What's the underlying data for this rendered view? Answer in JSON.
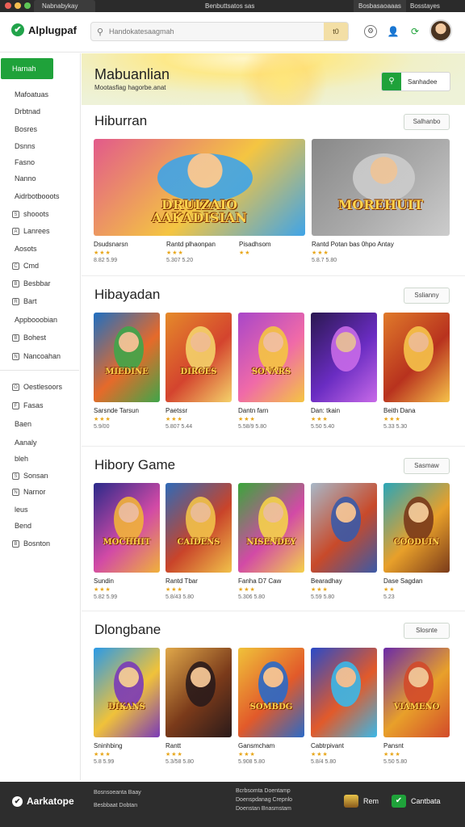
{
  "os_bar": {
    "tab_title": "Nabnabykay",
    "center_text": "Benbuttsatos  sas",
    "right_tab": "Bosbasaoaaas",
    "right_text": "Bosstayes"
  },
  "header": {
    "logo": "Alplugpaf",
    "search_placeholder": "Handokatesaagmah",
    "search_button": "t0"
  },
  "sidebar": {
    "active": "Harnah",
    "items": [
      {
        "label": "Mafoatuas",
        "icon": ""
      },
      {
        "label": "Drbtnad",
        "icon": ""
      },
      {
        "label": "Bosres",
        "icon": ""
      },
      {
        "label": "Dsnns",
        "icon": ""
      },
      {
        "label": "Fasno",
        "icon": ""
      },
      {
        "label": "Nanno",
        "icon": ""
      },
      {
        "label": "Aidrbotbooots",
        "icon": ""
      },
      {
        "label": "shooots",
        "icon": "S"
      },
      {
        "label": "Lanrees",
        "icon": "A"
      },
      {
        "label": "Aosots",
        "icon": ""
      },
      {
        "label": "Cmd",
        "icon": "C"
      },
      {
        "label": "Besbbar",
        "icon": "B"
      },
      {
        "label": "Bart",
        "icon": "R"
      },
      {
        "label": "Appbooobian",
        "icon": ""
      },
      {
        "label": "Bohest",
        "icon": "B"
      },
      {
        "label": "Nancoahan",
        "icon": "N"
      },
      {
        "label": "Oestlesoors",
        "icon": "O"
      },
      {
        "label": "Fasas",
        "icon": "F"
      },
      {
        "label": "Baen",
        "icon": ""
      },
      {
        "label": "Aanaly",
        "icon": ""
      },
      {
        "label": "bleh",
        "icon": ""
      },
      {
        "label": "Sonsan",
        "icon": "S"
      },
      {
        "label": "Narnor",
        "icon": "N"
      },
      {
        "label": "leus",
        "icon": ""
      },
      {
        "label": "Bend",
        "icon": ""
      },
      {
        "label": "Bosnton",
        "icon": "B"
      }
    ]
  },
  "hero": {
    "title": "Mabuanlian",
    "subtitle": "Mootasfiag hagorbe.anat",
    "button": "Sanhadee"
  },
  "sections": [
    {
      "title": "Hiburran",
      "more": "Salhanbo",
      "cards": [
        {
          "name": "Dsudsnarsn",
          "stars": "★★★",
          "meta": "8.82 5.99",
          "label": "DRUIZAIO\nAAKADISIAN"
        },
        {
          "name": "Rantd plhaonpan",
          "stars": "★★★",
          "meta": "5.307 5.20",
          "label": ""
        },
        {
          "name": "Pisadhsom",
          "stars": "★★",
          "meta": "",
          "label": ""
        },
        {
          "name": "Rantd Potan bas 0hpo Antay",
          "stars": "★★★",
          "meta": "5.8.7 5.80",
          "label": "MOREHUIT"
        }
      ]
    },
    {
      "title": "Hibayadan",
      "more": "Sslianny",
      "cards": [
        {
          "name": "Sarsnde Tarsun",
          "stars": "★★★",
          "meta": "5.9/00",
          "label": "MIEDINE"
        },
        {
          "name": "Paetssr",
          "stars": "★★★",
          "meta": "5.807 5.44",
          "label": "DIRGES"
        },
        {
          "name": "Dantn farn",
          "stars": "★★★",
          "meta": "5.58/9 5.80",
          "label": "SONARS"
        },
        {
          "name": "Dan: tkain",
          "stars": "★★★",
          "meta": "5.50 5.40",
          "label": ""
        },
        {
          "name": "Beith Dana",
          "stars": "★★★",
          "meta": "5.33 5.30",
          "label": ""
        }
      ]
    },
    {
      "title": "Hibory Game",
      "more": "Sasmaw",
      "cards": [
        {
          "name": "Sundin",
          "stars": "★★★",
          "meta": "5.82 5.99",
          "label": "MOCHHIT"
        },
        {
          "name": "Rantd Tbar",
          "stars": "★★★",
          "meta": "5.8/43 5.80",
          "label": "CAIDENS"
        },
        {
          "name": "Fanha D7 Caw",
          "stars": "★★★",
          "meta": "5.306 5.80",
          "label": "NISENDEY"
        },
        {
          "name": "Bearadhay",
          "stars": "★★★",
          "meta": "5.59 5.80",
          "label": ""
        },
        {
          "name": "Dase Sagdan",
          "stars": "★★",
          "meta": "5.23",
          "label": "COODUIN"
        }
      ]
    },
    {
      "title": "Dlongbane",
      "more": "Slosnte",
      "cards": [
        {
          "name": "Sninhbing",
          "stars": "★★★",
          "meta": "5.8 5.99",
          "label": "DIKANS"
        },
        {
          "name": "Rantt",
          "stars": "★★★",
          "meta": "5.3/58 5.80",
          "label": ""
        },
        {
          "name": "Gansmcham",
          "stars": "★★★",
          "meta": "5.908 5.80",
          "label": "SOMBDG"
        },
        {
          "name": "Cabtrpivant",
          "stars": "★★★",
          "meta": "5.8/4 5.80",
          "label": ""
        },
        {
          "name": "Pansnt",
          "stars": "★★★",
          "meta": "5.50 5.80",
          "label": "VIAMENO"
        }
      ]
    }
  ],
  "footer": {
    "logo": "Aarkatope",
    "col1_line1": "Bosnsoeanta Baay",
    "col1_line2": "Besbbaat Dobtan",
    "col2_line1": "Bcrbsomta Doentamp",
    "col2_line2": "Doenspdanag Crepnlo",
    "col2_line3": "Doenstan Bnasmstam",
    "btn1": "Rem",
    "btn2": "Cantbata"
  },
  "colors": {
    "accent": "#1fa23a",
    "footer_bg": "#2d2d2d",
    "star": "#e8a619"
  }
}
